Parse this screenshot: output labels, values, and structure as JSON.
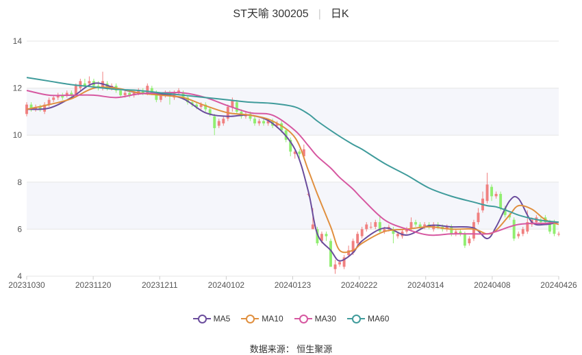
{
  "title": {
    "name": "ST天喻 300205",
    "period": "日K"
  },
  "source": "数据来源： 恒生聚源",
  "legend": [
    {
      "label": "MA5",
      "color": "#6a4c9c"
    },
    {
      "label": "MA10",
      "color": "#e08f3e"
    },
    {
      "label": "MA30",
      "color": "#d657a0"
    },
    {
      "label": "MA60",
      "color": "#3f9b9b"
    }
  ],
  "colors": {
    "up": "#f08080",
    "down": "#90ee70",
    "band": "#f5f6fb",
    "grid": "#e6e6e6"
  },
  "chart_data": {
    "type": "candlestick",
    "ylim": [
      4,
      14
    ],
    "yticks": [
      4,
      6,
      8,
      10,
      12,
      14
    ],
    "x_tick_labels": [
      "20231030",
      "20231120",
      "20231211",
      "20240102",
      "20240123",
      "20240222",
      "20240314",
      "20240408",
      "20240426"
    ],
    "n_days": 120,
    "grid": true,
    "legend_position": "bottom",
    "candles": [
      {
        "o": 10.9,
        "c": 11.3,
        "h": 11.4,
        "l": 10.8
      },
      {
        "o": 11.3,
        "c": 11.1,
        "h": 11.4,
        "l": 11.0
      },
      {
        "o": 11.1,
        "c": 11.2,
        "h": 11.3,
        "l": 11.0
      },
      {
        "o": 11.2,
        "c": 11.1,
        "h": 11.3,
        "l": 11.0
      },
      {
        "o": 11.0,
        "c": 11.3,
        "h": 11.4,
        "l": 10.9
      },
      {
        "o": 11.3,
        "c": 11.5,
        "h": 11.6,
        "l": 11.2
      },
      {
        "o": 11.5,
        "c": 11.6,
        "h": 11.7,
        "l": 11.4
      },
      {
        "o": 11.6,
        "c": 11.7,
        "h": 11.8,
        "l": 11.5
      },
      {
        "o": 11.7,
        "c": 11.6,
        "h": 11.8,
        "l": 11.5
      },
      {
        "o": 11.7,
        "c": 11.8,
        "h": 11.9,
        "l": 11.6
      },
      {
        "o": 11.8,
        "c": 11.7,
        "h": 11.9,
        "l": 11.6
      },
      {
        "o": 11.7,
        "c": 12.1,
        "h": 12.2,
        "l": 11.6
      },
      {
        "o": 12.0,
        "c": 12.3,
        "h": 12.4,
        "l": 11.9
      },
      {
        "o": 12.2,
        "c": 12.1,
        "h": 12.4,
        "l": 12.0
      },
      {
        "o": 12.2,
        "c": 12.3,
        "h": 12.5,
        "l": 12.1
      },
      {
        "o": 12.3,
        "c": 12.1,
        "h": 12.4,
        "l": 12.0
      },
      {
        "o": 12.1,
        "c": 12.0,
        "h": 12.3,
        "l": 11.9
      },
      {
        "o": 12.0,
        "c": 12.3,
        "h": 12.7,
        "l": 11.9
      },
      {
        "o": 12.2,
        "c": 12.0,
        "h": 12.3,
        "l": 11.9
      },
      {
        "o": 12.0,
        "c": 12.1,
        "h": 12.2,
        "l": 11.9
      },
      {
        "o": 12.1,
        "c": 11.9,
        "h": 12.2,
        "l": 11.8
      },
      {
        "o": 11.9,
        "c": 11.7,
        "h": 12.0,
        "l": 11.6
      },
      {
        "o": 11.7,
        "c": 11.8,
        "h": 11.9,
        "l": 11.6
      },
      {
        "o": 11.8,
        "c": 11.7,
        "h": 11.9,
        "l": 11.6
      },
      {
        "o": 11.7,
        "c": 11.8,
        "h": 11.9,
        "l": 11.6
      },
      {
        "o": 11.8,
        "c": 11.9,
        "h": 12.0,
        "l": 11.7
      },
      {
        "o": 11.9,
        "c": 11.8,
        "h": 12.0,
        "l": 11.7
      },
      {
        "o": 11.8,
        "c": 12.1,
        "h": 12.2,
        "l": 11.7
      },
      {
        "o": 12.0,
        "c": 11.8,
        "h": 12.1,
        "l": 11.7
      },
      {
        "o": 11.8,
        "c": 11.5,
        "h": 11.9,
        "l": 11.4
      },
      {
        "o": 11.5,
        "c": 11.7,
        "h": 11.8,
        "l": 11.4
      },
      {
        "o": 11.7,
        "c": 11.8,
        "h": 11.9,
        "l": 11.6
      },
      {
        "o": 11.8,
        "c": 11.7,
        "h": 11.9,
        "l": 11.3
      },
      {
        "o": 11.6,
        "c": 11.8,
        "h": 11.9,
        "l": 11.5
      },
      {
        "o": 11.8,
        "c": 11.9,
        "h": 12.0,
        "l": 11.7
      },
      {
        "o": 11.8,
        "c": 11.6,
        "h": 11.9,
        "l": 11.5
      },
      {
        "o": 11.6,
        "c": 11.4,
        "h": 11.7,
        "l": 11.3
      },
      {
        "o": 11.4,
        "c": 11.3,
        "h": 11.5,
        "l": 11.2
      },
      {
        "o": 11.3,
        "c": 11.2,
        "h": 11.4,
        "l": 11.1
      },
      {
        "o": 11.2,
        "c": 11.3,
        "h": 11.4,
        "l": 11.1
      },
      {
        "o": 11.3,
        "c": 11.1,
        "h": 11.4,
        "l": 11.0
      },
      {
        "o": 11.1,
        "c": 10.9,
        "h": 11.2,
        "l": 10.8
      },
      {
        "o": 10.8,
        "c": 10.3,
        "h": 10.9,
        "l": 10.0
      },
      {
        "o": 10.4,
        "c": 10.6,
        "h": 10.7,
        "l": 10.3
      },
      {
        "o": 10.5,
        "c": 10.7,
        "h": 10.8,
        "l": 10.4
      },
      {
        "o": 10.7,
        "c": 11.2,
        "h": 11.3,
        "l": 10.6
      },
      {
        "o": 11.2,
        "c": 11.5,
        "h": 11.6,
        "l": 11.0
      },
      {
        "o": 11.4,
        "c": 11.0,
        "h": 11.5,
        "l": 10.9
      },
      {
        "o": 11.0,
        "c": 10.8,
        "h": 11.1,
        "l": 10.7
      },
      {
        "o": 10.8,
        "c": 10.9,
        "h": 11.0,
        "l": 10.7
      },
      {
        "o": 10.9,
        "c": 10.7,
        "h": 11.0,
        "l": 10.6
      },
      {
        "o": 10.7,
        "c": 10.5,
        "h": 10.8,
        "l": 10.4
      },
      {
        "o": 10.5,
        "c": 10.6,
        "h": 10.7,
        "l": 10.4
      },
      {
        "o": 10.6,
        "c": 10.5,
        "h": 10.7,
        "l": 10.4
      },
      {
        "o": 10.5,
        "c": 10.6,
        "h": 10.7,
        "l": 10.4
      },
      {
        "o": 10.6,
        "c": 10.4,
        "h": 10.7,
        "l": 10.3
      },
      {
        "o": 10.4,
        "c": 10.5,
        "h": 10.6,
        "l": 10.3
      },
      {
        "o": 10.5,
        "c": 10.2,
        "h": 10.6,
        "l": 10.1
      },
      {
        "o": 10.2,
        "c": 9.8,
        "h": 10.3,
        "l": 9.7
      },
      {
        "o": 9.8,
        "c": 9.3,
        "h": 9.9,
        "l": 9.1
      },
      {
        "o": 9.2,
        "c": 9.3,
        "h": 9.4,
        "l": 9.0
      },
      {
        "o": 9.3,
        "c": 9.2,
        "h": 9.4,
        "l": 9.0
      },
      {
        "o": 9.1,
        "c": 9.4,
        "h": 9.6,
        "l": 9.0
      },
      {
        "o": 7.5,
        "c": 7.5,
        "h": 7.6,
        "l": 7.4
      },
      {
        "o": 6.0,
        "c": 6.2,
        "h": 6.9,
        "l": 6.0
      },
      {
        "o": 6.0,
        "c": 5.4,
        "h": 6.1,
        "l": 5.3
      },
      {
        "o": 5.5,
        "c": 5.8,
        "h": 5.9,
        "l": 5.4
      },
      {
        "o": 5.8,
        "c": 5.7,
        "h": 5.9,
        "l": 5.5
      },
      {
        "o": 5.5,
        "c": 4.4,
        "h": 5.6,
        "l": 4.4
      },
      {
        "o": 4.3,
        "c": 4.5,
        "h": 4.7,
        "l": 4.1
      },
      {
        "o": 4.5,
        "c": 4.6,
        "h": 4.7,
        "l": 4.4
      },
      {
        "o": 4.4,
        "c": 4.8,
        "h": 4.9,
        "l": 4.3
      },
      {
        "o": 4.9,
        "c": 5.1,
        "h": 5.3,
        "l": 4.8
      },
      {
        "o": 5.0,
        "c": 5.5,
        "h": 5.6,
        "l": 4.9
      },
      {
        "o": 5.4,
        "c": 5.8,
        "h": 5.9,
        "l": 5.3
      },
      {
        "o": 5.7,
        "c": 6.0,
        "h": 6.1,
        "l": 5.6
      },
      {
        "o": 6.0,
        "c": 6.2,
        "h": 6.3,
        "l": 5.9
      },
      {
        "o": 6.1,
        "c": 6.1,
        "h": 6.3,
        "l": 6.0
      },
      {
        "o": 6.1,
        "c": 6.3,
        "h": 6.4,
        "l": 6.0
      },
      {
        "o": 6.3,
        "c": 5.9,
        "h": 6.6,
        "l": 5.8
      },
      {
        "o": 5.9,
        "c": 6.0,
        "h": 6.1,
        "l": 5.8
      },
      {
        "o": 6.0,
        "c": 6.1,
        "h": 6.2,
        "l": 5.9
      },
      {
        "o": 6.0,
        "c": 5.8,
        "h": 6.1,
        "l": 5.4
      },
      {
        "o": 5.7,
        "c": 5.8,
        "h": 5.9,
        "l": 5.6
      },
      {
        "o": 5.7,
        "c": 5.9,
        "h": 6.0,
        "l": 5.6
      },
      {
        "o": 5.9,
        "c": 6.0,
        "h": 6.1,
        "l": 5.8
      },
      {
        "o": 6.0,
        "c": 6.3,
        "h": 6.5,
        "l": 5.9
      },
      {
        "o": 6.3,
        "c": 6.2,
        "h": 6.4,
        "l": 6.1
      },
      {
        "o": 6.2,
        "c": 6.1,
        "h": 6.3,
        "l": 6.0
      },
      {
        "o": 6.1,
        "c": 6.2,
        "h": 6.3,
        "l": 6.0
      },
      {
        "o": 6.2,
        "c": 6.1,
        "h": 6.3,
        "l": 6.0
      },
      {
        "o": 6.0,
        "c": 6.2,
        "h": 6.3,
        "l": 5.9
      },
      {
        "o": 6.2,
        "c": 6.1,
        "h": 6.3,
        "l": 6.0
      },
      {
        "o": 6.1,
        "c": 6.0,
        "h": 6.2,
        "l": 5.9
      },
      {
        "o": 6.0,
        "c": 6.1,
        "h": 6.2,
        "l": 5.9
      },
      {
        "o": 6.1,
        "c": 5.8,
        "h": 6.2,
        "l": 5.7
      },
      {
        "o": 5.8,
        "c": 5.9,
        "h": 6.0,
        "l": 5.7
      },
      {
        "o": 5.9,
        "c": 5.8,
        "h": 6.0,
        "l": 5.7
      },
      {
        "o": 5.8,
        "c": 5.3,
        "h": 5.9,
        "l": 5.2
      },
      {
        "o": 5.4,
        "c": 5.6,
        "h": 5.7,
        "l": 5.3
      },
      {
        "o": 5.6,
        "c": 6.3,
        "h": 6.4,
        "l": 5.5
      },
      {
        "o": 6.3,
        "c": 6.7,
        "h": 6.9,
        "l": 6.2
      },
      {
        "o": 6.8,
        "c": 7.3,
        "h": 7.6,
        "l": 6.7
      },
      {
        "o": 7.2,
        "c": 7.9,
        "h": 8.4,
        "l": 7.1
      },
      {
        "o": 7.8,
        "c": 7.4,
        "h": 7.9,
        "l": 7.2
      },
      {
        "o": 7.4,
        "c": 7.5,
        "h": 7.6,
        "l": 7.3
      },
      {
        "o": 7.5,
        "c": 6.9,
        "h": 7.6,
        "l": 6.8
      },
      {
        "o": 6.9,
        "c": 6.6,
        "h": 7.0,
        "l": 6.5
      },
      {
        "o": 6.6,
        "c": 6.5,
        "h": 6.7,
        "l": 6.4
      },
      {
        "o": 6.4,
        "c": 5.6,
        "h": 6.5,
        "l": 5.5
      },
      {
        "o": 5.7,
        "c": 5.8,
        "h": 5.9,
        "l": 5.6
      },
      {
        "o": 5.8,
        "c": 6.0,
        "h": 6.1,
        "l": 5.7
      },
      {
        "o": 5.9,
        "c": 6.3,
        "h": 6.8,
        "l": 5.8
      },
      {
        "o": 6.2,
        "c": 6.4,
        "h": 6.5,
        "l": 6.1
      },
      {
        "o": 6.3,
        "c": 6.5,
        "h": 6.6,
        "l": 6.2
      },
      {
        "o": 6.4,
        "c": 6.3,
        "h": 6.5,
        "l": 6.2
      },
      {
        "o": 6.5,
        "c": 6.3,
        "h": 6.6,
        "l": 6.2
      },
      {
        "o": 6.3,
        "c": 5.9,
        "h": 6.4,
        "l": 5.8
      },
      {
        "o": 6.3,
        "c": 5.8,
        "h": 6.4,
        "l": 5.7
      },
      {
        "o": 5.8,
        "c": 5.8,
        "h": 5.9,
        "l": 5.7
      }
    ],
    "series": [
      {
        "name": "MA5",
        "days": [
          0,
          5,
          10,
          15,
          20,
          25,
          30,
          35,
          40,
          45,
          50,
          55,
          60,
          63,
          65,
          68,
          70,
          73,
          75,
          80,
          85,
          90,
          95,
          100,
          103,
          105,
          108,
          110,
          113,
          116,
          119
        ],
        "values": [
          11.1,
          11.15,
          11.6,
          12.2,
          12.0,
          11.8,
          11.75,
          11.55,
          10.95,
          10.8,
          10.85,
          10.5,
          9.4,
          7.6,
          5.8,
          5.1,
          4.65,
          5.0,
          5.5,
          6.05,
          5.75,
          6.15,
          6.1,
          6.05,
          5.6,
          6.1,
          7.2,
          7.3,
          6.3,
          6.2,
          6.3
        ]
      },
      {
        "name": "MA10",
        "days": [
          0,
          5,
          10,
          15,
          20,
          25,
          30,
          35,
          40,
          45,
          50,
          55,
          60,
          63,
          65,
          68,
          70,
          73,
          75,
          80,
          85,
          90,
          95,
          100,
          103,
          105,
          108,
          110,
          113,
          116,
          119
        ],
        "values": [
          11.1,
          11.3,
          11.55,
          12.0,
          12.0,
          11.8,
          11.7,
          11.6,
          11.25,
          10.95,
          10.85,
          10.6,
          9.9,
          8.5,
          7.5,
          6.1,
          5.1,
          5.1,
          5.4,
          5.9,
          6.0,
          6.1,
          6.0,
          6.0,
          5.8,
          5.95,
          6.6,
          7.0,
          6.85,
          6.4,
          6.2
        ]
      },
      {
        "name": "MA30",
        "days": [
          0,
          5,
          10,
          15,
          20,
          25,
          30,
          35,
          40,
          45,
          50,
          55,
          60,
          63,
          65,
          68,
          70,
          73,
          75,
          80,
          85,
          90,
          95,
          100,
          103,
          105,
          108,
          110,
          113,
          116,
          119
        ],
        "values": [
          11.9,
          11.7,
          11.7,
          11.7,
          11.6,
          11.75,
          11.8,
          11.8,
          11.6,
          11.25,
          10.95,
          10.85,
          10.2,
          9.55,
          9.1,
          8.6,
          8.2,
          7.7,
          7.3,
          6.4,
          6.0,
          5.75,
          5.8,
          5.8,
          5.8,
          5.9,
          6.1,
          6.2,
          6.25,
          6.25,
          6.3
        ]
      },
      {
        "name": "MA60",
        "days": [
          0,
          5,
          10,
          15,
          20,
          25,
          30,
          35,
          40,
          45,
          50,
          55,
          60,
          63,
          65,
          68,
          70,
          73,
          75,
          80,
          85,
          90,
          95,
          100,
          103,
          105,
          108,
          110,
          113,
          116,
          119
        ],
        "values": [
          12.45,
          12.3,
          12.15,
          12.05,
          11.95,
          11.9,
          11.8,
          11.7,
          11.6,
          11.5,
          11.4,
          11.35,
          11.2,
          10.9,
          10.6,
          10.2,
          9.95,
          9.6,
          9.4,
          8.8,
          8.3,
          7.75,
          7.4,
          7.15,
          7.0,
          6.95,
          6.75,
          6.6,
          6.45,
          6.35,
          6.3
        ]
      }
    ]
  }
}
